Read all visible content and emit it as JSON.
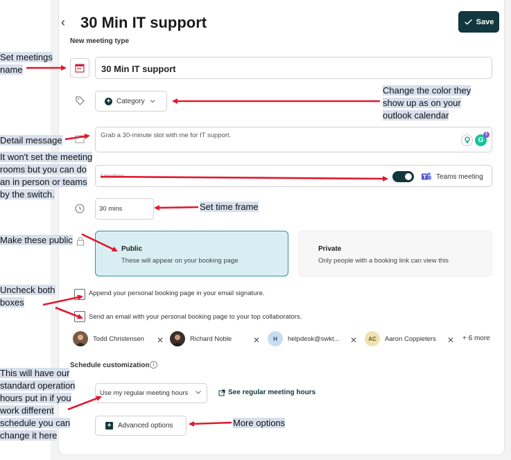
{
  "header": {
    "title": "30 Min IT support",
    "save_label": "Save"
  },
  "form": {
    "section_meeting_type": "New meeting type",
    "name_value": "30 Min IT support",
    "category_label": "Category",
    "description_value": "Grab a 30-minute slot with me for IT support.",
    "location_placeholder": "Location",
    "teams_label": "Teams meeting",
    "teams_enabled": true,
    "duration_value": "30 mins",
    "visibility": {
      "selected": "public",
      "public": {
        "title": "Public",
        "subtitle": "These will appear on your booking page"
      },
      "private": {
        "title": "Private",
        "subtitle": "Only people with a booking link can view this"
      }
    },
    "checkbox_signature_label": "Append your personal booking page in your email signature.",
    "checkbox_email_label": "Send an email with your personal booking page to your top collaborators.",
    "collaborators": [
      {
        "name": "Todd Christensen",
        "initials": "",
        "color": "#7a5a44"
      },
      {
        "name": "Richard Noble",
        "initials": "",
        "color": "#3d2f28"
      },
      {
        "name": "helpdesk@swkt...",
        "initials": "H",
        "color": "#c9dcef"
      },
      {
        "name": "Aaron Coppieters",
        "initials": "AC",
        "color": "#efe2b0"
      }
    ],
    "more_collaborators": "+ 6 more",
    "section_schedule": "Schedule customization",
    "hours_select_value": "Use my regular meeting hours",
    "see_hours_link": "See regular meeting hours",
    "advanced_options_label": "Advanced options"
  },
  "annotations": {
    "name": [
      "Set meetings",
      "name"
    ],
    "category": [
      "Change the color they",
      "show up as on your",
      "outlook calendar"
    ],
    "detail": [
      "Detail message"
    ],
    "location": [
      "It won't set the meeting",
      "rooms but you can do",
      "an in person or teams",
      "by the switch."
    ],
    "time": [
      "Set time frame"
    ],
    "public": [
      "Make these public"
    ],
    "uncheck": [
      "Uncheck both",
      "boxes"
    ],
    "hours": [
      "This will have our",
      "standard operation",
      "hours put in if you",
      "work different",
      "schedule you can",
      "change it here"
    ],
    "more": [
      "More options"
    ]
  },
  "colors": {
    "accent": "#12373e",
    "annotation_highlight": "#d7e0ec",
    "arrow": "#e0182f"
  }
}
